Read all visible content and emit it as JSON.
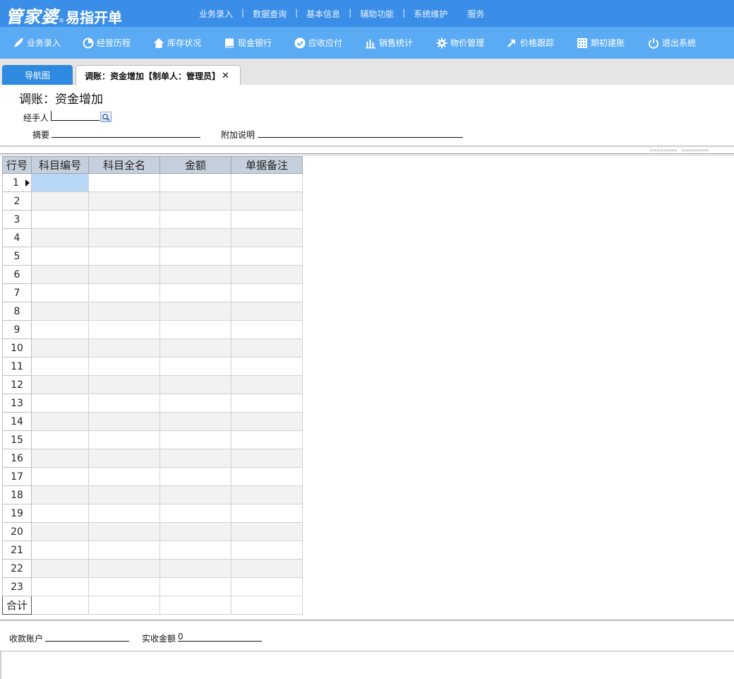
{
  "app": {
    "brand": "管家婆",
    "subtitle": "易指开单",
    "top_menu": [
      "业务录入",
      "数据查询",
      "基本信息",
      "辅助功能",
      "系统维护",
      "服务"
    ]
  },
  "toolbar": [
    {
      "label": "业务录入",
      "icon": "pencil-icon"
    },
    {
      "label": "经营历程",
      "icon": "pie-chart-icon"
    },
    {
      "label": "库存状况",
      "icon": "house-icon"
    },
    {
      "label": "现金银行",
      "icon": "book-icon"
    },
    {
      "label": "应收应付",
      "icon": "check-circle-icon"
    },
    {
      "label": "销售统计",
      "icon": "bar-chart-icon"
    },
    {
      "label": "物价管理",
      "icon": "gear-icon"
    },
    {
      "label": "价格跟踪",
      "icon": "arrow-up-right-icon"
    },
    {
      "label": "期初建账",
      "icon": "calculator-icon"
    },
    {
      "label": "退出系统",
      "icon": "power-icon"
    }
  ],
  "tabs": {
    "nav": "导航图",
    "active": "调账：资金增加【制单人：管理员】"
  },
  "form": {
    "title": "调账：资金增加",
    "handler_label": "经手人",
    "handler_value": "",
    "summary_label": "摘要",
    "summary_value": "",
    "note_label": "附加说明",
    "note_value": ""
  },
  "grid": {
    "columns": [
      "行号",
      "科目编号",
      "科目全名",
      "金额",
      "单据备注"
    ],
    "rows": [
      1,
      2,
      3,
      4,
      5,
      6,
      7,
      8,
      9,
      10,
      11,
      12,
      13,
      14,
      15,
      16,
      17,
      18,
      19,
      20,
      21,
      22,
      23
    ],
    "total_label": "合计"
  },
  "footer": {
    "account_label": "收款账户",
    "account_value": "",
    "amount_label": "实收金额",
    "amount_value": "0"
  }
}
